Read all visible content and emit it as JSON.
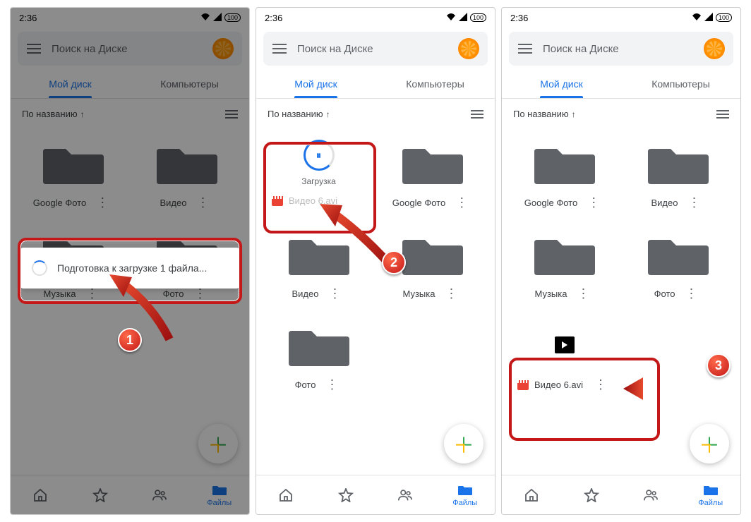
{
  "status": {
    "time": "2:36",
    "battery": "100"
  },
  "search": {
    "placeholder": "Поиск на Диске"
  },
  "tabs": {
    "my_drive": "Мой диск",
    "computers": "Компьютеры"
  },
  "sort": {
    "label": "По названию",
    "arrow": "↑"
  },
  "nav": {
    "files": "Файлы"
  },
  "snackbar": {
    "text": "Подготовка к загрузке 1 файла..."
  },
  "upload": {
    "status": "Загрузка",
    "filename": "Видео 6.avi",
    "pause_glyph": "⏸"
  },
  "folders": {
    "google_photos": "Google Фото",
    "video": "Видео",
    "music": "Музыка",
    "photo": "Фото"
  },
  "file": {
    "name": "Видео 6.avi"
  },
  "badges": {
    "one": "1",
    "two": "2",
    "three": "3"
  }
}
